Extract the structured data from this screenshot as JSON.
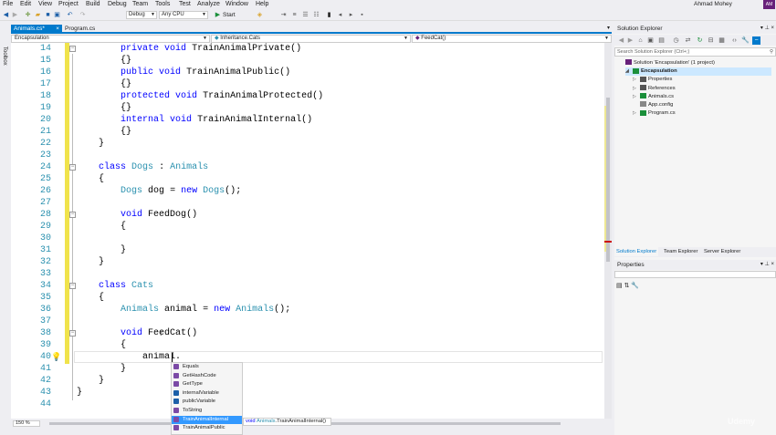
{
  "menu": [
    "File",
    "Edit",
    "View",
    "Project",
    "Build",
    "Debug",
    "Team",
    "Tools",
    "Test",
    "Analyze",
    "Window",
    "Help"
  ],
  "user": {
    "name": "Ahmad Mohey",
    "initials": "AM"
  },
  "toolbar": {
    "config": "Debug",
    "platform": "Any CPU",
    "start_label": "Start"
  },
  "left_tab": "Toolbox",
  "doc_tabs": [
    {
      "label": "Animals.cs*",
      "active": true
    },
    {
      "label": "Program.cs",
      "active": false
    }
  ],
  "nav": {
    "project": "Encapsulation",
    "class": "Inheritance.Cats",
    "member": "FeedCat()"
  },
  "code": {
    "line_numbers": [
      "14",
      "15",
      "16",
      "17",
      "18",
      "19",
      "20",
      "21",
      "22",
      "23",
      "24",
      "25",
      "26",
      "27",
      "28",
      "29",
      "30",
      "31",
      "32",
      "33",
      "34",
      "35",
      "36",
      "37",
      "38",
      "39",
      "40",
      "41",
      "42",
      "43",
      "44"
    ],
    "lines": [
      "        private void TrainAnimalPrivate()",
      "        {}",
      "        public void TrainAnimalPublic()",
      "        {}",
      "        protected void TrainAnimalProtected()",
      "        {}",
      "        internal void TrainAnimalInternal()",
      "        {}",
      "    }",
      "",
      "    class Dogs : Animals",
      "    {",
      "        Dogs dog = new Dogs();",
      "",
      "        void FeedDog()",
      "        {",
      "",
      "        }",
      "    }",
      "",
      "    class Cats",
      "    {",
      "        Animals animal = new Animals();",
      "",
      "        void FeedCat()",
      "        {",
      "            animal.",
      "        }",
      "    }",
      "}",
      ""
    ]
  },
  "zoom": "150 %",
  "completion": {
    "items": [
      {
        "label": "Equals",
        "kind": "method",
        "selected": false
      },
      {
        "label": "GetHashCode",
        "kind": "method",
        "selected": false
      },
      {
        "label": "GetType",
        "kind": "method",
        "selected": false
      },
      {
        "label": "internalVariable",
        "kind": "field",
        "selected": false
      },
      {
        "label": "publicVariable",
        "kind": "field",
        "selected": false
      },
      {
        "label": "ToString",
        "kind": "method",
        "selected": false
      },
      {
        "label": "TrainAnimalInternal",
        "kind": "method",
        "selected": true
      },
      {
        "label": "TrainAnimalPublic",
        "kind": "method",
        "selected": false
      }
    ],
    "tooltip": {
      "ret": "void",
      "type": "Animals",
      "member": ".TrainAnimalInternal()"
    }
  },
  "solution_explorer": {
    "title": "Solution Explorer",
    "search_placeholder": "Search Solution Explorer (Ctrl+;)",
    "tree": [
      {
        "label": "Solution 'Encapsulation' (1 project)",
        "depth": 0,
        "bold": false,
        "icon": "solution-icon"
      },
      {
        "label": "Encapsulation",
        "depth": 1,
        "bold": true,
        "icon": "csproj-icon"
      },
      {
        "label": "Properties",
        "depth": 2,
        "bold": false,
        "icon": "wrench-icon"
      },
      {
        "label": "References",
        "depth": 2,
        "bold": false,
        "icon": "references-icon"
      },
      {
        "label": "Animals.cs",
        "depth": 2,
        "bold": false,
        "icon": "csharp-file-icon"
      },
      {
        "label": "App.config",
        "depth": 2,
        "bold": false,
        "icon": "config-file-icon"
      },
      {
        "label": "Program.cs",
        "depth": 2,
        "bold": false,
        "icon": "csharp-file-icon"
      }
    ],
    "tabs": [
      "Solution Explorer",
      "Team Explorer",
      "Server Explorer"
    ]
  },
  "properties": {
    "title": "Properties"
  },
  "watermark": "Udemy",
  "colors": {
    "accent": "#007acc",
    "keyword": "#0000ff",
    "type": "#2b91af",
    "selection": "#3399ff"
  }
}
